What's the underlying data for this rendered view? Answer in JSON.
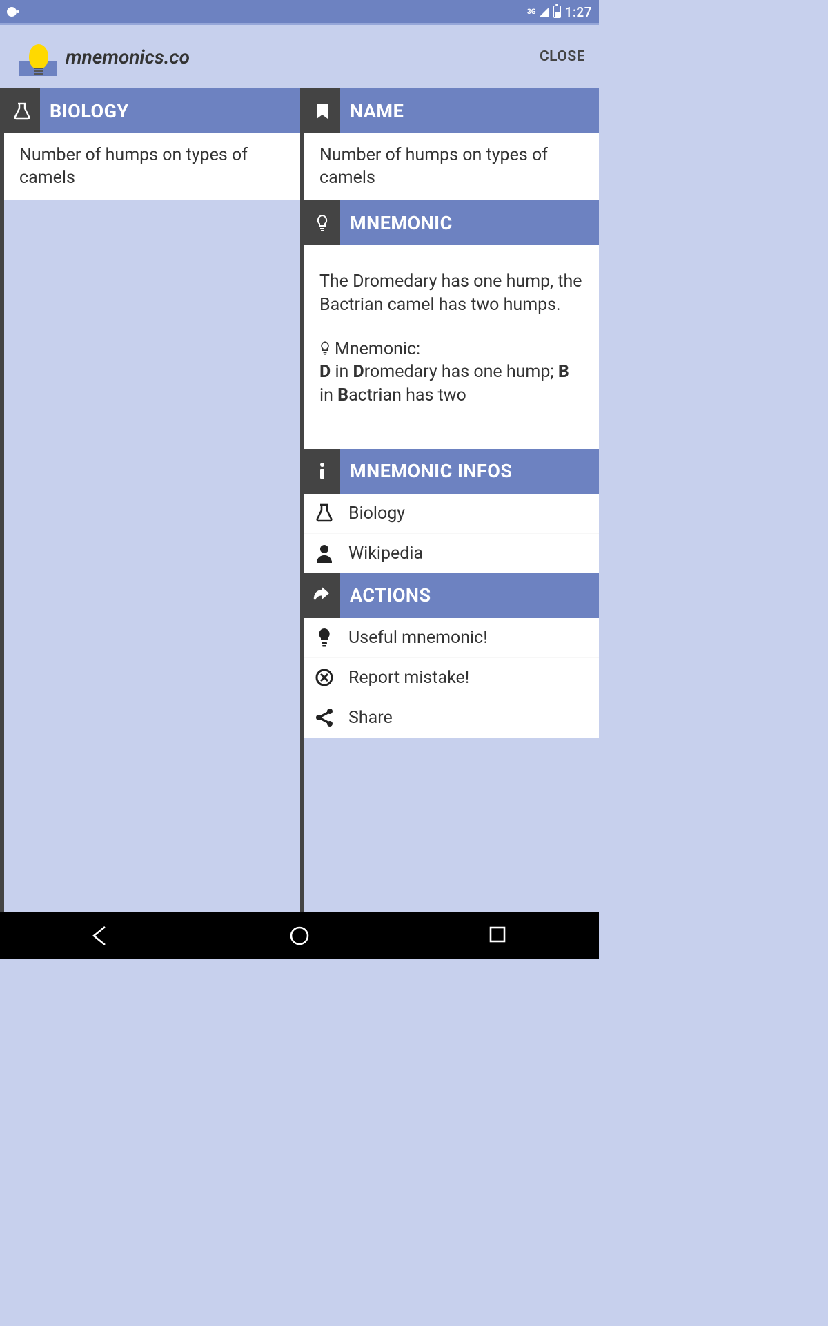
{
  "status_bar": {
    "network_label": "3G",
    "time": "1:27"
  },
  "app_bar": {
    "title": "mnemonics.co",
    "close_label": "CLOSE"
  },
  "left_pane": {
    "header": "BIOLOGY",
    "item": "Number of humps on types of camels"
  },
  "right_pane": {
    "name": {
      "header": "NAME",
      "value": "Number of humps on types of camels"
    },
    "mnemonic": {
      "header": "MNEMONIC",
      "intro": "The Dromedary has one hump, the Bactrian camel has two humps.",
      "label": "Mnemonic:",
      "line_pre_d1": "",
      "d1": "D",
      "mid1": " in ",
      "d2": "D",
      "after_d2": "romedary has one hump; ",
      "b1": "B",
      "mid2": " in ",
      "b2": "B",
      "after_b2": "actrian has two"
    },
    "infos": {
      "header": "MNEMONIC INFOS",
      "items": [
        {
          "label": "Biology"
        },
        {
          "label": "Wikipedia"
        }
      ]
    },
    "actions": {
      "header": "ACTIONS",
      "items": [
        {
          "label": "Useful mnemonic!"
        },
        {
          "label": "Report mistake!"
        },
        {
          "label": "Share"
        }
      ]
    }
  }
}
